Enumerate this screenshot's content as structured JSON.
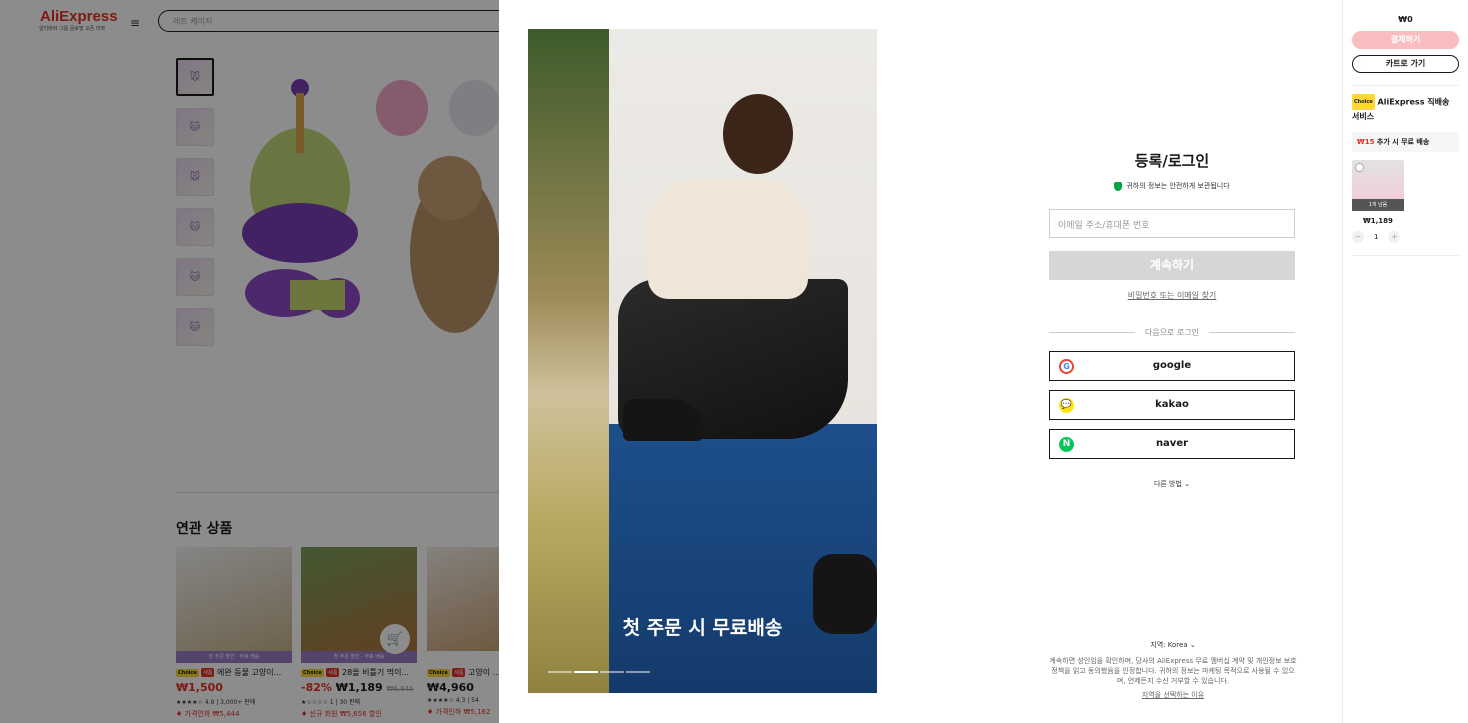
{
  "header": {
    "logo": "AliExpress",
    "logo_sub": "알리바바 그룹 글로벌 오픈 마켓",
    "search_placeholder": "레트 케이지"
  },
  "product": {
    "thumbs": [
      "🐭",
      "🐱",
      "🐭",
      "🐱",
      "🐱",
      "🐱"
    ]
  },
  "related": {
    "title": "연관 상품",
    "items": [
      {
        "strip": "첫 주문 할인 · 무료 배송",
        "name": "에완 동물 고양이...",
        "price": "₩1,500",
        "pct": "",
        "old": "",
        "rating": "★★★★☆ 4.9 | 3,000+ 판매",
        "disc": "♦ 가격인하 ₩5,444"
      },
      {
        "strip": "첫 주문 할인 · 무료 배송",
        "name": "28올 비틀기 먹이...",
        "price": "₩1,189",
        "pct": "-82%",
        "old": "₩6,845",
        "rating": "★☆☆☆☆ 1 | 30 판매",
        "disc": "♦ 신규 회원 ₩5,656 할인"
      },
      {
        "strip": "",
        "name": "고양이 ...",
        "price": "₩4,960",
        "pct": "",
        "old": "",
        "rating": "★★★★☆ 4.3 | 54",
        "disc": "♦ 가격인하 ₩5,162"
      }
    ],
    "badge_choice": "Choice",
    "badge_new": "새품"
  },
  "modal": {
    "photo_caption": "첫 주문 시 무료배송",
    "title": "등록/로그인",
    "safe_text": "귀하의 정보는 안전하게 보관됩니다",
    "email_placeholder": "이메일 주소/휴대폰 번호",
    "continue_label": "계속하기",
    "forgot_label": "비밀번호 또는 이메일 찾기",
    "separator": "다음으로 로그인",
    "social": [
      {
        "label": "google",
        "icon": "G"
      },
      {
        "label": "kakao",
        "icon": "💬"
      },
      {
        "label": "naver",
        "icon": "N"
      }
    ],
    "other_methods": "다른 방법 ⌄",
    "region_label": "지역:",
    "region_value": "Korea ⌄",
    "terms": "계속하면 성인임을 확인하며, 당사의 AliExpress 무료 멤버십 계약 및 개인정보 보호정책을 읽고 동의했음을 인정합니다. 귀하의 정보는 마케팅 목적으로 사용될 수 있으며, 언제든지 수신 거부할 수 있습니다.",
    "why_region": "지역을 선택하는 이유"
  },
  "cart_panel": {
    "total": "₩0",
    "checkout_label": "결제하기",
    "go_cart_label": "카트로 가기",
    "choice_badge": "Choice",
    "service_label": "AliExpress 직배송 서비스",
    "ship_amount": "₩15",
    "ship_text": "추가 시 무료 배송",
    "item_badge": "1개 남음",
    "item_price": "₩1,189",
    "qty": "1",
    "minus": "−",
    "plus": "+"
  }
}
